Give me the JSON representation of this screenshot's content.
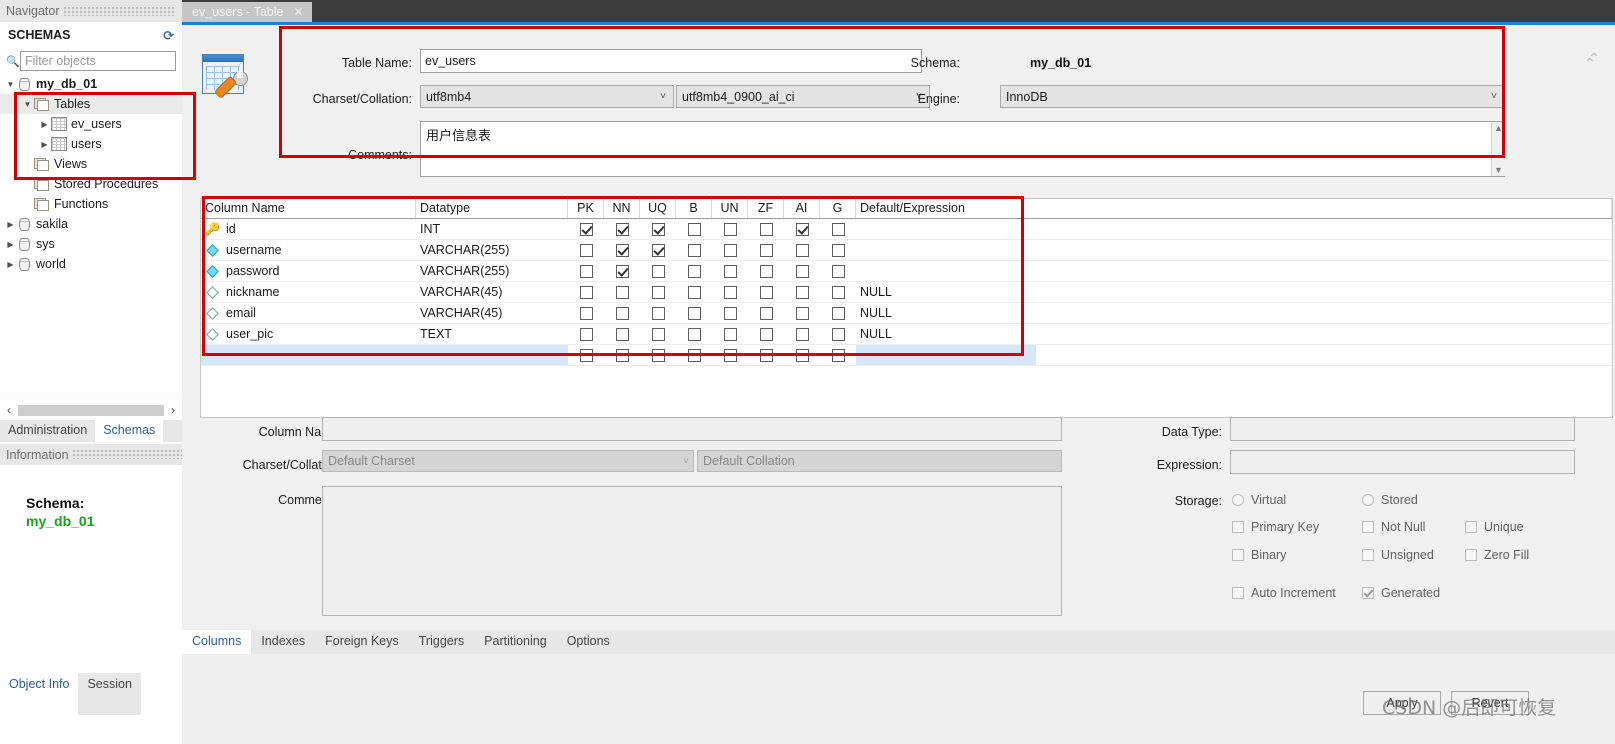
{
  "app": {
    "navigator_title": "Navigator",
    "schemas_title": "SCHEMAS",
    "refresh_icon": "refresh-icon",
    "filter_placeholder": "Filter objects",
    "search_icon": "search-icon"
  },
  "sidebar": {
    "tree": [
      {
        "label": "my_db_01",
        "icon": "database-icon",
        "expanded": true,
        "indent": 0,
        "bold": true,
        "selected": false
      },
      {
        "label": "Tables",
        "icon": "folder-icon",
        "expanded": true,
        "indent": 1,
        "bold": false,
        "selected": true
      },
      {
        "label": "ev_users",
        "icon": "table-icon",
        "expanded": false,
        "indent": 2,
        "bold": false,
        "selected": false
      },
      {
        "label": "users",
        "icon": "table-icon",
        "expanded": false,
        "indent": 2,
        "bold": false,
        "selected": false
      },
      {
        "label": "Views",
        "icon": "folder-icon",
        "expanded": null,
        "indent": 1,
        "bold": false,
        "selected": false
      },
      {
        "label": "Stored Procedures",
        "icon": "folder-icon",
        "expanded": null,
        "indent": 1,
        "bold": false,
        "selected": false
      },
      {
        "label": "Functions",
        "icon": "folder-icon",
        "expanded": null,
        "indent": 1,
        "bold": false,
        "selected": false
      },
      {
        "label": "sakila",
        "icon": "database-icon",
        "expanded": false,
        "indent": 0,
        "bold": false,
        "selected": false
      },
      {
        "label": "sys",
        "icon": "database-icon",
        "expanded": false,
        "indent": 0,
        "bold": false,
        "selected": false
      },
      {
        "label": "world",
        "icon": "database-icon",
        "expanded": false,
        "indent": 0,
        "bold": false,
        "selected": false
      }
    ],
    "panel_tabs": [
      {
        "label": "Administration",
        "active": false
      },
      {
        "label": "Schemas",
        "active": true
      }
    ],
    "information_title": "Information",
    "object_info": {
      "key": "Schema:",
      "value": "my_db_01"
    },
    "bottom_tabs": [
      {
        "label": "Object Info",
        "active": true
      },
      {
        "label": "Session",
        "active": false
      }
    ],
    "scroll_left_icon": "chevron-left-icon",
    "scroll_right_icon": "chevron-right-icon"
  },
  "document_tab": {
    "title": "ev_users - Table",
    "close_icon": "close-icon"
  },
  "table_editor": {
    "icon": "table-editor-icon",
    "collapse_icon": "double-chevron-up-icon",
    "labels": {
      "table_name": "Table Name:",
      "charset_collation": "Charset/Collation:",
      "comments": "Comments:",
      "schema": "Schema:",
      "engine": "Engine:"
    },
    "values": {
      "table_name": "ev_users",
      "charset": "utf8mb4",
      "collation": "utf8mb4_0900_ai_ci",
      "comments": "用户信息表",
      "schema": "my_db_01",
      "engine": "InnoDB"
    }
  },
  "columns_grid": {
    "headers": [
      "Column Name",
      "Datatype",
      "PK",
      "NN",
      "UQ",
      "B",
      "UN",
      "ZF",
      "AI",
      "G",
      "Default/Expression"
    ],
    "rows": [
      {
        "name": "id",
        "key_icon": "primary-key-icon",
        "datatype": "INT",
        "pk": true,
        "nn": true,
        "uq": true,
        "b": false,
        "un": false,
        "zf": false,
        "ai": true,
        "g": false,
        "default": ""
      },
      {
        "name": "username",
        "key_icon": "filled-diamond-icon",
        "datatype": "VARCHAR(255)",
        "pk": false,
        "nn": true,
        "uq": true,
        "b": false,
        "un": false,
        "zf": false,
        "ai": false,
        "g": false,
        "default": ""
      },
      {
        "name": "password",
        "key_icon": "filled-diamond-icon",
        "datatype": "VARCHAR(255)",
        "pk": false,
        "nn": true,
        "uq": false,
        "b": false,
        "un": false,
        "zf": false,
        "ai": false,
        "g": false,
        "default": ""
      },
      {
        "name": "nickname",
        "key_icon": "hollow-diamond-icon",
        "datatype": "VARCHAR(45)",
        "pk": false,
        "nn": false,
        "uq": false,
        "b": false,
        "un": false,
        "zf": false,
        "ai": false,
        "g": false,
        "default": "NULL"
      },
      {
        "name": "email",
        "key_icon": "hollow-diamond-icon",
        "datatype": "VARCHAR(45)",
        "pk": false,
        "nn": false,
        "uq": false,
        "b": false,
        "un": false,
        "zf": false,
        "ai": false,
        "g": false,
        "default": "NULL"
      },
      {
        "name": "user_pic",
        "key_icon": "hollow-diamond-icon",
        "datatype": "TEXT",
        "pk": false,
        "nn": false,
        "uq": false,
        "b": false,
        "un": false,
        "zf": false,
        "ai": false,
        "g": false,
        "default": "NULL"
      },
      {
        "name": "",
        "key_icon": "",
        "datatype": "",
        "pk": false,
        "nn": false,
        "uq": false,
        "b": false,
        "un": false,
        "zf": false,
        "ai": false,
        "g": false,
        "default": "",
        "is_new": true
      }
    ]
  },
  "column_detail": {
    "labels": {
      "column_name": "Column Name:",
      "charset_collation": "Charset/Collation:",
      "comments": "Comments:",
      "data_type": "Data Type:",
      "expression": "Expression:",
      "storage": "Storage:"
    },
    "values": {
      "column_name": "",
      "charset_placeholder": "Default Charset",
      "collation_placeholder": "Default Collation",
      "comments": "",
      "data_type": "",
      "expression": ""
    },
    "storage_options": [
      {
        "label": "Virtual",
        "type": "radio",
        "checked": false
      },
      {
        "label": "Stored",
        "type": "radio",
        "checked": false
      }
    ],
    "flags": [
      {
        "label": "Primary Key",
        "checked": false
      },
      {
        "label": "Not Null",
        "checked": false
      },
      {
        "label": "Unique",
        "checked": false
      },
      {
        "label": "Binary",
        "checked": false
      },
      {
        "label": "Unsigned",
        "checked": false
      },
      {
        "label": "Zero Fill",
        "checked": false
      },
      {
        "label": "Auto Increment",
        "checked": false
      },
      {
        "label": "Generated",
        "checked": true
      }
    ]
  },
  "editor_tabs": [
    {
      "label": "Columns",
      "active": true
    },
    {
      "label": "Indexes",
      "active": false
    },
    {
      "label": "Foreign Keys",
      "active": false
    },
    {
      "label": "Triggers",
      "active": false
    },
    {
      "label": "Partitioning",
      "active": false
    },
    {
      "label": "Options",
      "active": false
    }
  ],
  "action_buttons": {
    "apply": "Apply",
    "revert": "Revert"
  },
  "watermark": "CSDN @后即可恢复",
  "colors": {
    "accent_blue": "#1f7fd0",
    "annotation_red": "#d40000",
    "link_blue": "#2a6099",
    "schema_green": "#19a319",
    "new_row_blue": "#d6e7fa"
  }
}
